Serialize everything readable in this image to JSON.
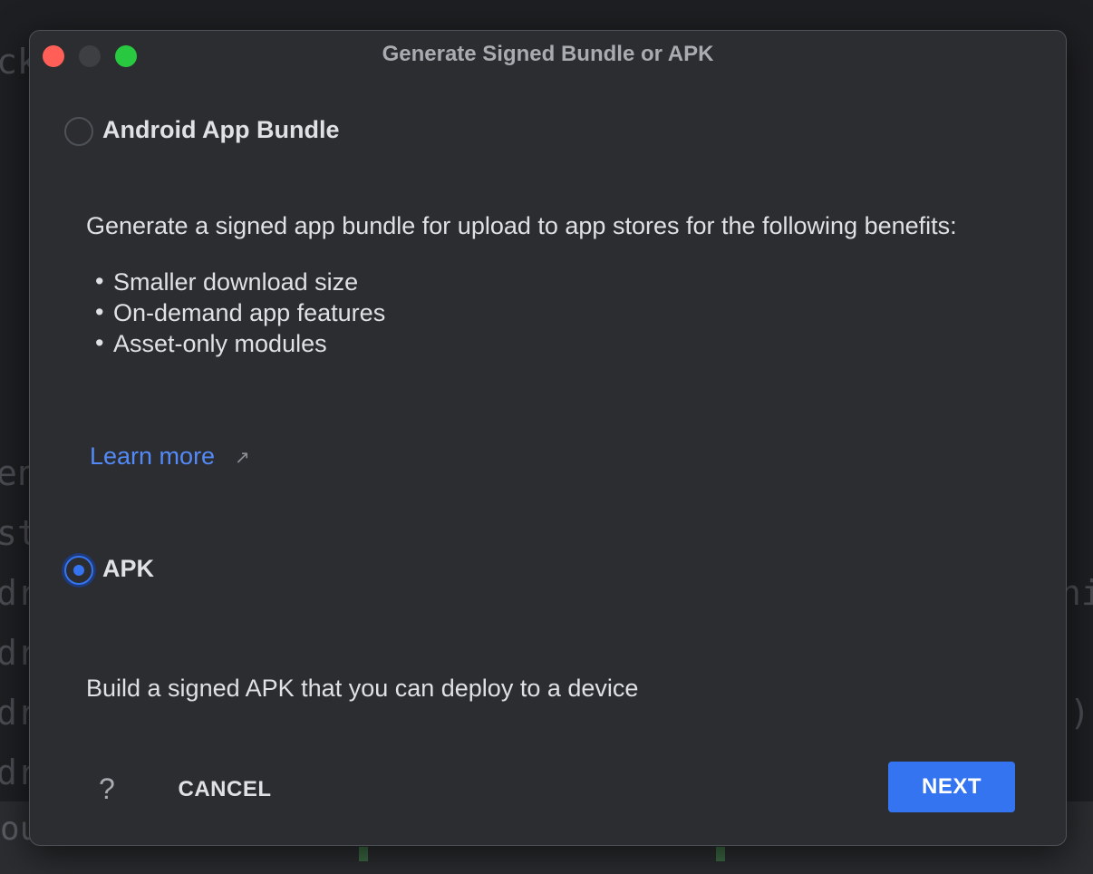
{
  "dialog": {
    "title": "Generate Signed Bundle or APK"
  },
  "bundle_option": {
    "label": "Android App Bundle",
    "selected": false,
    "description": "Generate a signed app bundle for upload to app stores for the following benefits:",
    "benefits": [
      "Smaller download size",
      "On-demand app features",
      "Asset-only modules"
    ],
    "learn_more": "Learn more",
    "learn_more_icon": "external-link-arrow"
  },
  "apk_option": {
    "label": "APK",
    "selected": true,
    "description": "Build a signed APK that you can deploy to a device"
  },
  "footer": {
    "help": "?",
    "cancel_label": "CANCEL",
    "next_label": "NEXT"
  },
  "colors": {
    "accent": "#3574f0",
    "link": "#548af7",
    "dialog_bg": "#2b2d30",
    "close": "#ff5f57",
    "maximize": "#28c840"
  }
}
